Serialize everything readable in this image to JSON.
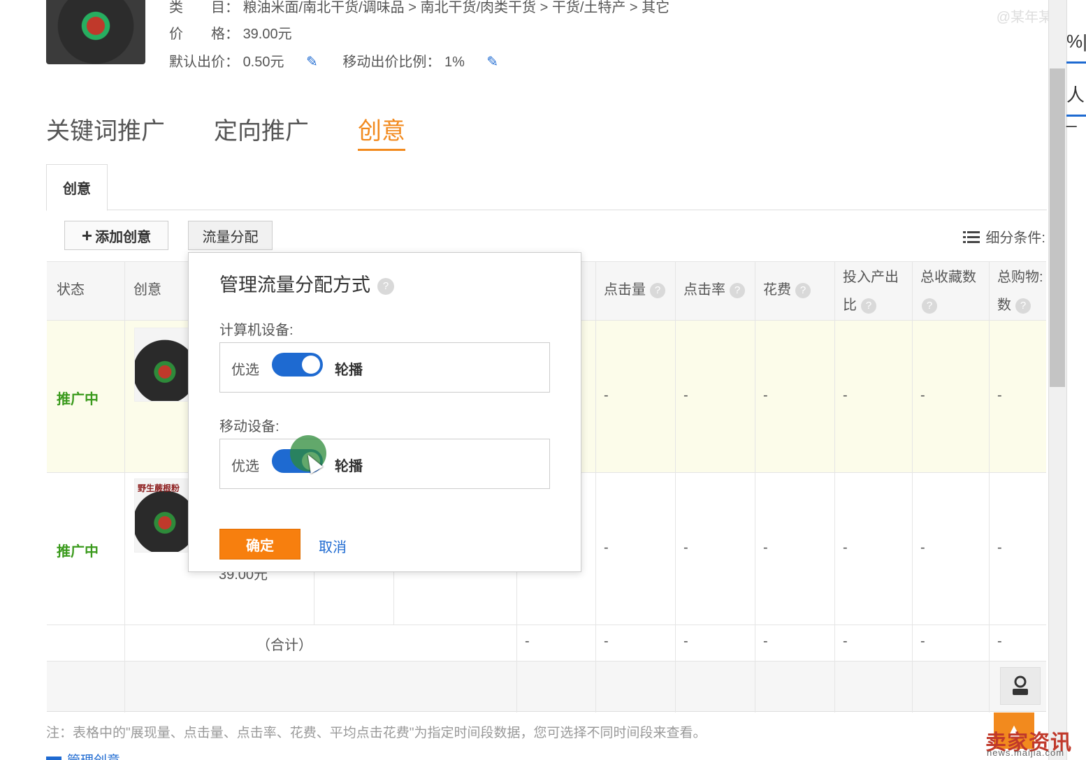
{
  "product": {
    "category_label": "类　　目：",
    "category_value": "粮油米面/南北干货/调味品 > 南北干货/肉类干货 > 干货/土特产 > 其它",
    "price_label": "价　　格：",
    "price_value": "39.00元",
    "default_bid_label": "默认出价：",
    "default_bid_value": "0.50元",
    "mobile_ratio_label": "移动出价比例：",
    "mobile_ratio_value": "1%"
  },
  "watermark_top": "@某年某月某",
  "main_tabs": [
    {
      "label": "关键词推广",
      "active": false
    },
    {
      "label": "定向推广",
      "active": false
    },
    {
      "label": "创意",
      "active": true
    }
  ],
  "sub_tab": "创意",
  "toolbar": {
    "add_icon": "+",
    "add_label": "添加创意",
    "flow_label": "流量分配",
    "filter_icon": "list-icon",
    "filter_label": "细分条件:"
  },
  "table": {
    "headers": {
      "status": "状态",
      "creative": "创意",
      "clicks": "点击量",
      "ctr": "点击率",
      "cost": "花费",
      "roi_line1": "投入产出",
      "roi_line2": "比",
      "fav_line1": "总收藏数",
      "cart_line1": "总购物:",
      "cart_line2": "数"
    },
    "rows": [
      {
        "status": "推广中",
        "thumb_text": "",
        "values": [
          "-",
          "-",
          "-",
          "-",
          "-",
          "-"
        ]
      },
      {
        "status": "推广中",
        "thumb_text": "野生蕨根粉",
        "values": [
          "-",
          "-",
          "-",
          "-",
          "-",
          "-"
        ]
      }
    ],
    "price_tail": "39.00元",
    "total_label": "（合计）",
    "total_values": [
      "-",
      "-",
      "-",
      "-",
      "-",
      "-",
      "-"
    ]
  },
  "note": "注：表格中的\"展现量、点击量、点击率、花费、平均点击花费\"为指定时间段数据，您可选择不同时间段来查看。",
  "manage_link": "管理创意",
  "popover": {
    "title": "管理流量分配方式",
    "pc_label": "计算机设备:",
    "mobile_label": "移动设备:",
    "option_left": "优选",
    "option_right": "轮播",
    "pc_selected": "轮播",
    "mobile_selected": "轮播",
    "confirm": "确定",
    "cancel": "取消"
  },
  "side_sliver": {
    "text_a": "%|",
    "text_b": "人_"
  },
  "brand_watermark": "卖家资讯",
  "brand_url": "news.maijia.com",
  "colors": {
    "accent": "#f28a1e",
    "link": "#1e6ad1",
    "active_status": "#3a9a1c",
    "highlight_row": "#fcfcea"
  }
}
